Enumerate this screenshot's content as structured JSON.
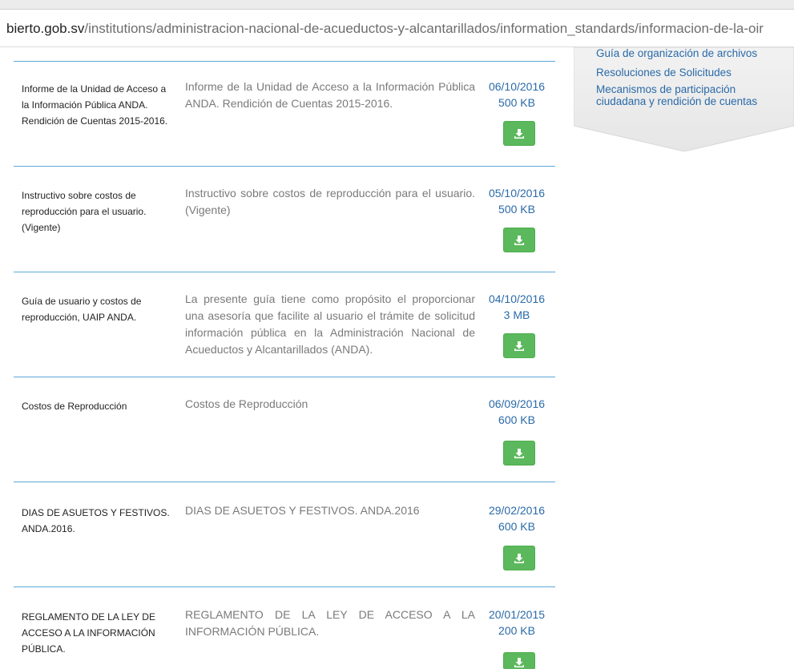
{
  "browser": {
    "url_host": "bierto.gob.sv",
    "url_path": "/institutions/administracion-nacional-de-acueductos-y-alcantarillados/information_standards/informacion-de-la-oir"
  },
  "sidebar": {
    "links": [
      "Guía de organización de archivos",
      "Resoluciones de Solicitudes",
      "Mecanismos de participación ciudadana y rendición de cuentas"
    ]
  },
  "documents": [
    {
      "title": "Informe de la Unidad de Acceso a la Información Pública ANDA. Rendición de Cuentas 2015-2016.",
      "description": "Informe de la Unidad de Acceso a la Información Pública ANDA. Rendición de Cuentas 2015-2016.",
      "date": "06/10/2016",
      "size": "500 KB"
    },
    {
      "title": "Instructivo sobre costos de reproducción para el usuario. (Vigente)",
      "description": "Instructivo sobre costos de reproducción para el usuario. (Vigente)",
      "date": "05/10/2016",
      "size": "500 KB"
    },
    {
      "title": "Guía de usuario y costos de reproducción, UAIP ANDA.",
      "description": "La presente guía tiene como propósito el proporcionar una asesoría que facilite al usuario el trámite de solicitud información pública en la Administración Nacional de Acueductos y Alcantarillados (ANDA).",
      "date": "04/10/2016",
      "size": "3 MB"
    },
    {
      "title": "Costos de Reproducción",
      "description": "Costos de Reproducción",
      "date": "06/09/2016",
      "size": "600 KB"
    },
    {
      "title": "DIAS DE ASUETOS Y FESTIVOS. ANDA.2016.",
      "description": "DIAS DE ASUETOS Y FESTIVOS. ANDA.2016",
      "date": "29/02/2016",
      "size": "600 KB"
    },
    {
      "title": "REGLAMENTO DE LA LEY DE ACCESO A LA INFORMACIÓN PÚBLICA.",
      "description": "REGLAMENTO DE LA LEY DE ACCESO A LA INFORMACIÓN PÚBLICA.",
      "date": "20/01/2015",
      "size": "200 KB"
    }
  ],
  "icons": {
    "download": "download-icon"
  },
  "colors": {
    "link": "#2a6aa8",
    "rule": "#5ba6d5",
    "button": "#5cb85c"
  }
}
